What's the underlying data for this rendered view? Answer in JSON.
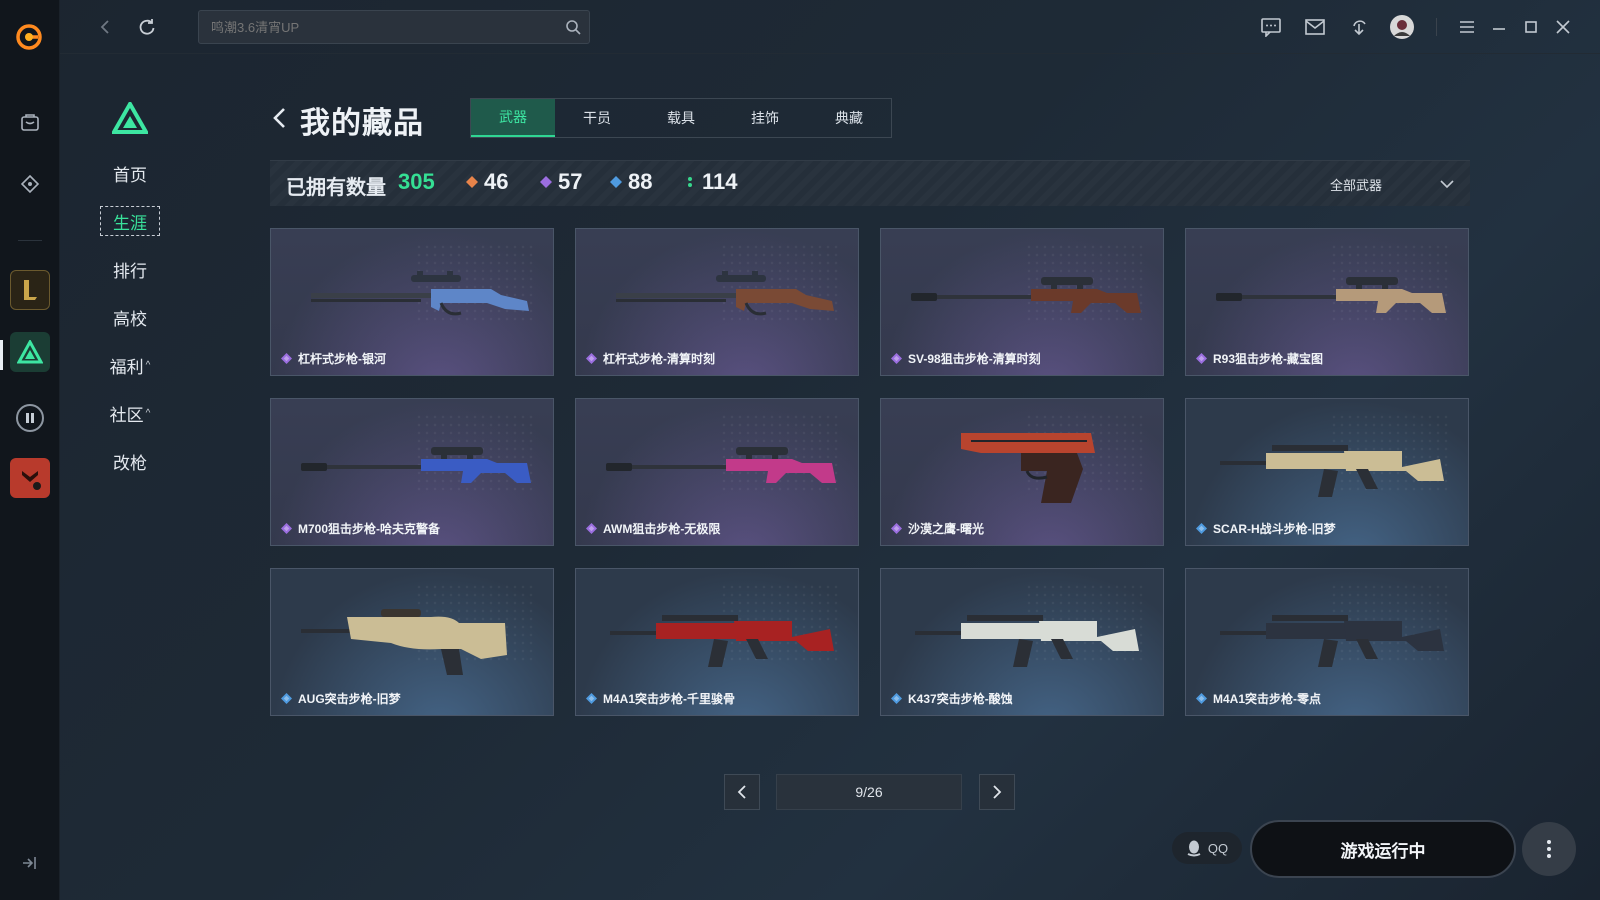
{
  "search": {
    "placeholder": "鸣潮3.6清宵UP"
  },
  "subnav": {
    "items": [
      {
        "label": "首页",
        "active": false,
        "caret": ""
      },
      {
        "label": "生涯",
        "active": true,
        "caret": ""
      },
      {
        "label": "排行",
        "active": false,
        "caret": ""
      },
      {
        "label": "高校",
        "active": false,
        "caret": ""
      },
      {
        "label": "福利",
        "active": false,
        "caret": "^"
      },
      {
        "label": "社区",
        "active": false,
        "caret": "^"
      },
      {
        "label": "改枪",
        "active": false,
        "caret": ""
      }
    ]
  },
  "header": {
    "title": "我的藏品"
  },
  "tabs": [
    {
      "label": "武器",
      "active": true
    },
    {
      "label": "干员",
      "active": false
    },
    {
      "label": "载具",
      "active": false
    },
    {
      "label": "挂饰",
      "active": false
    },
    {
      "label": "典藏",
      "active": false
    }
  ],
  "stats": {
    "owned_label": "已拥有数量",
    "owned_count": "305",
    "tiers": [
      {
        "value": "46",
        "color": "#e8844a",
        "icon": "orange-diamond-icon"
      },
      {
        "value": "57",
        "color": "#9b6ee0",
        "icon": "purple-diamond-icon"
      },
      {
        "value": "88",
        "color": "#4f9be0",
        "icon": "blue-diamond-icon"
      },
      {
        "value": "114",
        "color": "#37d68c",
        "icon": "green-dot-icon"
      }
    ],
    "filter_label": "全部武器"
  },
  "items": [
    {
      "name": "杠杆式步枪-银河",
      "tier": "purple",
      "gun": "lever",
      "accent": "#5e86c8"
    },
    {
      "name": "杠杆式步枪-清算时刻",
      "tier": "purple",
      "gun": "lever",
      "accent": "#7a4a35"
    },
    {
      "name": "SV-98狙击步枪-清算时刻",
      "tier": "purple",
      "gun": "sniper",
      "accent": "#6b3a2a"
    },
    {
      "name": "R93狙击步枪-藏宝图",
      "tier": "purple",
      "gun": "sniper",
      "accent": "#b59a7a"
    },
    {
      "name": "M700狙击步枪-哈夫克警备",
      "tier": "purple",
      "gun": "sniper",
      "accent": "#3a5cc4"
    },
    {
      "name": "AWM狙击步枪-无极限",
      "tier": "purple",
      "gun": "sniper",
      "accent": "#c23a8a"
    },
    {
      "name": "沙漠之鹰-曙光",
      "tier": "purple",
      "gun": "pistol",
      "accent": "#b8442e"
    },
    {
      "name": "SCAR-H战斗步枪-旧梦",
      "tier": "blue",
      "gun": "rifle",
      "accent": "#cbbd95"
    },
    {
      "name": "AUG突击步枪-旧梦",
      "tier": "blue",
      "gun": "bullpup",
      "accent": "#cbbd95"
    },
    {
      "name": "M4A1突击步枪-千里骏骨",
      "tier": "blue",
      "gun": "rifle",
      "accent": "#a82222"
    },
    {
      "name": "K437突击步枪-酸蚀",
      "tier": "blue",
      "gun": "rifle",
      "accent": "#d8dcd6"
    },
    {
      "name": "M4A1突击步枪-零点",
      "tier": "blue",
      "gun": "rifle",
      "accent": "#2c3340"
    }
  ],
  "pagination": {
    "label": "9/26"
  },
  "bottom": {
    "qq_label": "QQ",
    "run_label": "游戏运行中"
  },
  "colors": {
    "accent_green": "#35df94",
    "tier_purple": "#9b6ee0",
    "tier_blue": "#4f9be0"
  }
}
